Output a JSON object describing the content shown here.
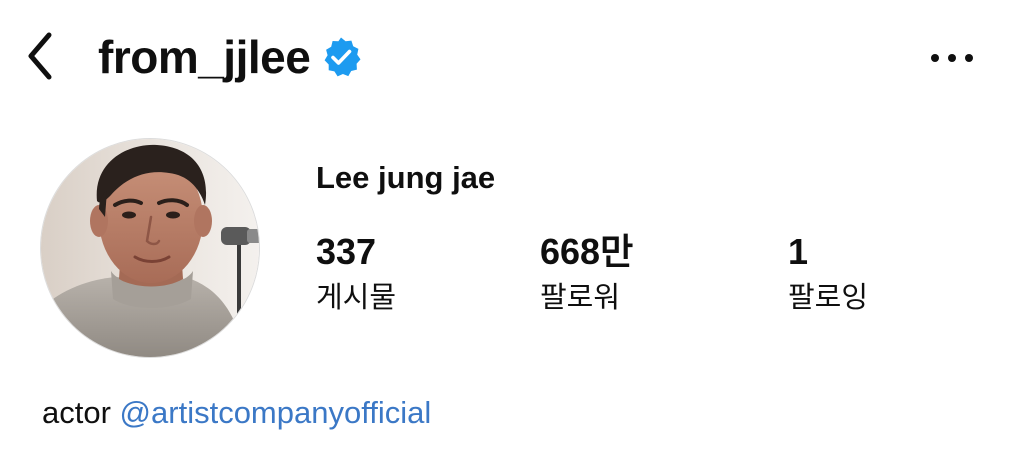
{
  "header": {
    "username": "from_jjlee",
    "verified": true,
    "back_icon": "chevron-left-icon",
    "more_icon": "more-horizontal-icon",
    "verified_icon": "verified-badge-icon"
  },
  "profile": {
    "display_name": "Lee jung jae",
    "avatar": "profile-photo",
    "stats": [
      {
        "count": "337",
        "label": "게시물"
      },
      {
        "count": "668만",
        "label": "팔로워"
      },
      {
        "count": "1",
        "label": "팔로잉"
      }
    ],
    "bio": {
      "text": "actor",
      "mention": "@artistcompanyofficial"
    }
  },
  "colors": {
    "text": "#0f0f0f",
    "link": "#3b78c6",
    "verified": "#1d9bf0",
    "background": "#ffffff"
  }
}
